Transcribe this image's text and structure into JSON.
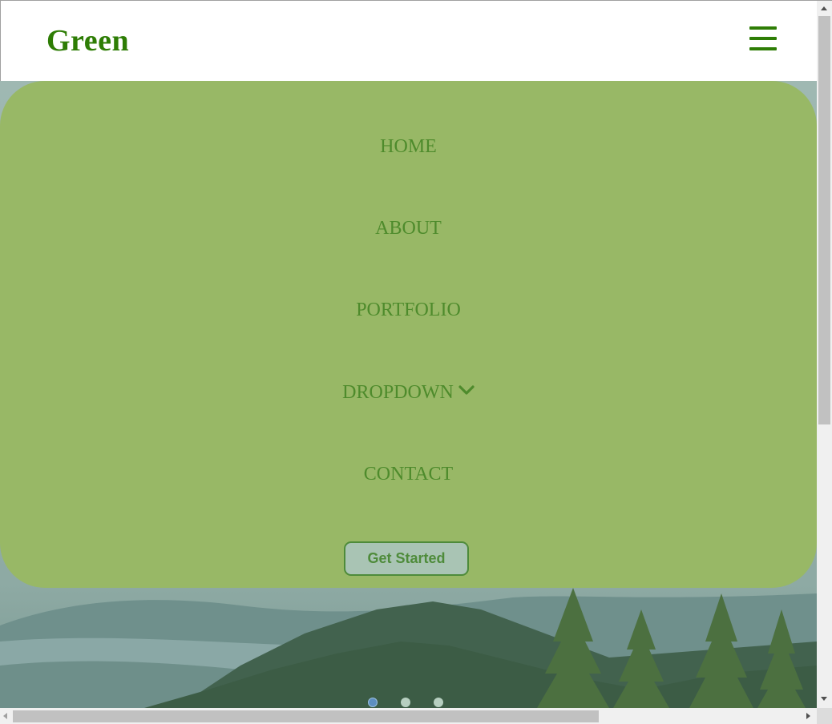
{
  "header": {
    "logo": "Green",
    "menu_icon": "hamburger-menu-icon"
  },
  "nav": {
    "items": [
      {
        "label": "HOME"
      },
      {
        "label": "ABOUT"
      },
      {
        "label": "PORTFOLIO"
      },
      {
        "label": "DROPDOWN",
        "icon": "chevron-down-icon"
      },
      {
        "label": "CONTACT"
      }
    ],
    "cta_label": "Get Started"
  },
  "carousel": {
    "slide_count": 3,
    "active_index": 0
  },
  "colors": {
    "brand": "#2e7d05",
    "nav_background": "#98b866",
    "nav_text": "#4e8b2c"
  }
}
